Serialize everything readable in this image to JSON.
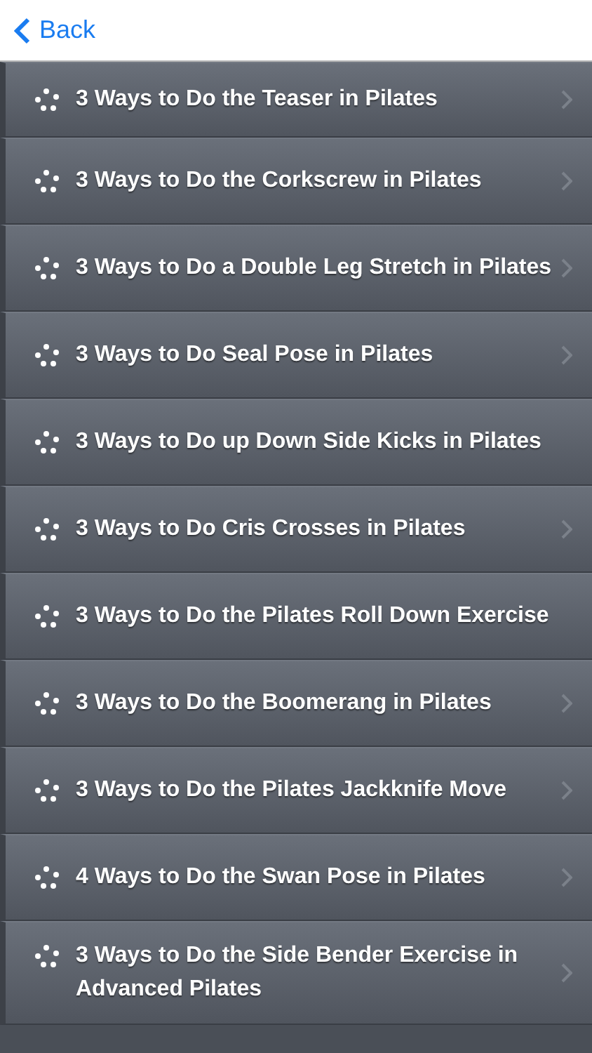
{
  "nav": {
    "back": "Back"
  },
  "items": [
    {
      "title": "3 Ways to Do the Teaser in Pilates",
      "chevron": true
    },
    {
      "title": "3 Ways to Do the Corkscrew in Pilates",
      "chevron": true
    },
    {
      "title": "3 Ways to Do a Double Leg Stretch in Pilates",
      "chevron": true
    },
    {
      "title": "3 Ways to Do Seal Pose in Pilates",
      "chevron": true
    },
    {
      "title": "3 Ways to Do up Down Side Kicks in Pilates",
      "chevron": false
    },
    {
      "title": "3 Ways to Do Cris Crosses in Pilates",
      "chevron": true
    },
    {
      "title": "3 Ways to Do the Pilates Roll Down Exercise",
      "chevron": false
    },
    {
      "title": "3 Ways to Do the Boomerang in Pilates",
      "chevron": true
    },
    {
      "title": "3 Ways to Do the Pilates Jackknife Move",
      "chevron": true
    },
    {
      "title": "4 Ways to Do the Swan Pose in Pilates",
      "chevron": true
    },
    {
      "title": "3 Ways to Do the Side Bender Exercise in Advanced Pilates",
      "chevron": true
    }
  ]
}
